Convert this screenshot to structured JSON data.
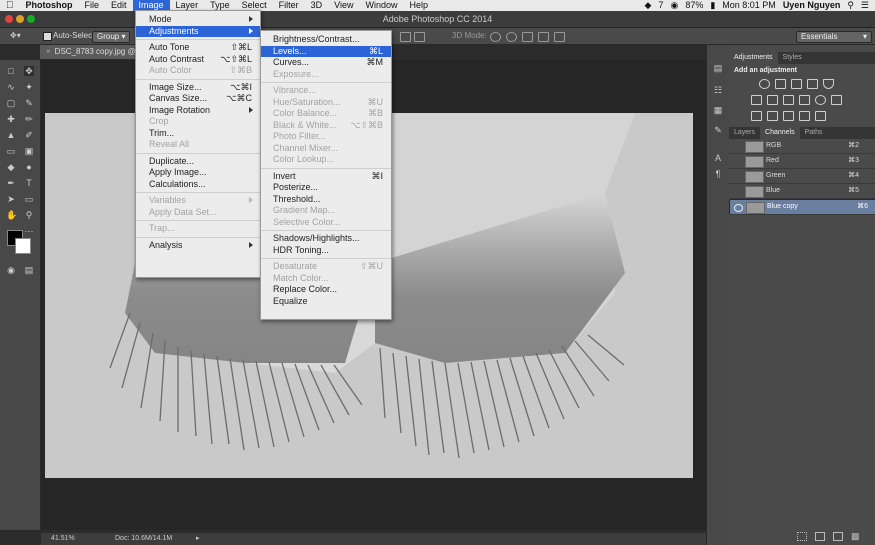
{
  "menubar": {
    "app": "Photoshop",
    "items": [
      "File",
      "Edit",
      "Image",
      "Layer",
      "Type",
      "Select",
      "Filter",
      "3D",
      "View",
      "Window",
      "Help"
    ],
    "active": "Image",
    "status": {
      "badge": "7",
      "battery": "87%",
      "clock": "Mon 8:01 PM",
      "user": "Uyen Nguyen"
    }
  },
  "window": {
    "title": "Adobe Photoshop CC 2014"
  },
  "options_bar": {
    "auto_select_label": "Auto-Select:",
    "auto_select_value": "Group",
    "mode_3d_label": "3D Mode:",
    "workspace": "Essentials"
  },
  "document": {
    "tab_label": "DSC_8783 copy.jpg @",
    "zoom": "41.51%",
    "doc_size": "Doc: 10.6M/14.1M"
  },
  "image_menu": [
    {
      "type": "item",
      "label": "Mode",
      "shortcut": "",
      "submenu": true,
      "disabled": false
    },
    {
      "type": "item",
      "label": "Adjustments",
      "shortcut": "",
      "submenu": true,
      "disabled": false,
      "highlighted": true
    },
    {
      "type": "sep"
    },
    {
      "type": "item",
      "label": "Auto Tone",
      "shortcut": "⇧⌘L",
      "disabled": false
    },
    {
      "type": "item",
      "label": "Auto Contrast",
      "shortcut": "⌥⇧⌘L",
      "disabled": false
    },
    {
      "type": "item",
      "label": "Auto Color",
      "shortcut": "⇧⌘B",
      "disabled": true
    },
    {
      "type": "sep"
    },
    {
      "type": "item",
      "label": "Image Size...",
      "shortcut": "⌥⌘I",
      "disabled": false
    },
    {
      "type": "item",
      "label": "Canvas Size...",
      "shortcut": "⌥⌘C",
      "disabled": false
    },
    {
      "type": "item",
      "label": "Image Rotation",
      "shortcut": "",
      "submenu": true,
      "disabled": false
    },
    {
      "type": "item",
      "label": "Crop",
      "shortcut": "",
      "disabled": true
    },
    {
      "type": "item",
      "label": "Trim...",
      "shortcut": "",
      "disabled": false
    },
    {
      "type": "item",
      "label": "Reveal All",
      "shortcut": "",
      "disabled": true
    },
    {
      "type": "sep"
    },
    {
      "type": "item",
      "label": "Duplicate...",
      "shortcut": "",
      "disabled": false
    },
    {
      "type": "item",
      "label": "Apply Image...",
      "shortcut": "",
      "disabled": false
    },
    {
      "type": "item",
      "label": "Calculations...",
      "shortcut": "",
      "disabled": false
    },
    {
      "type": "sep"
    },
    {
      "type": "item",
      "label": "Variables",
      "shortcut": "",
      "submenu": true,
      "disabled": true
    },
    {
      "type": "item",
      "label": "Apply Data Set...",
      "shortcut": "",
      "disabled": true
    },
    {
      "type": "sep"
    },
    {
      "type": "item",
      "label": "Trap...",
      "shortcut": "",
      "disabled": true
    },
    {
      "type": "sep"
    },
    {
      "type": "item",
      "label": "Analysis",
      "shortcut": "",
      "submenu": true,
      "disabled": false
    }
  ],
  "adjustments_menu": [
    {
      "type": "item",
      "label": "Brightness/Contrast...",
      "shortcut": "",
      "disabled": false
    },
    {
      "type": "item",
      "label": "Levels...",
      "shortcut": "⌘L",
      "disabled": false,
      "highlighted": true
    },
    {
      "type": "item",
      "label": "Curves...",
      "shortcut": "⌘M",
      "disabled": false
    },
    {
      "type": "item",
      "label": "Exposure...",
      "shortcut": "",
      "disabled": true
    },
    {
      "type": "sep"
    },
    {
      "type": "item",
      "label": "Vibrance...",
      "shortcut": "",
      "disabled": true
    },
    {
      "type": "item",
      "label": "Hue/Saturation...",
      "shortcut": "⌘U",
      "disabled": true
    },
    {
      "type": "item",
      "label": "Color Balance...",
      "shortcut": "⌘B",
      "disabled": true
    },
    {
      "type": "item",
      "label": "Black & White...",
      "shortcut": "⌥⇧⌘B",
      "disabled": true
    },
    {
      "type": "item",
      "label": "Photo Filter...",
      "shortcut": "",
      "disabled": true
    },
    {
      "type": "item",
      "label": "Channel Mixer...",
      "shortcut": "",
      "disabled": true
    },
    {
      "type": "item",
      "label": "Color Lookup...",
      "shortcut": "",
      "disabled": true
    },
    {
      "type": "sep"
    },
    {
      "type": "item",
      "label": "Invert",
      "shortcut": "⌘I",
      "disabled": false
    },
    {
      "type": "item",
      "label": "Posterize...",
      "shortcut": "",
      "disabled": false
    },
    {
      "type": "item",
      "label": "Threshold...",
      "shortcut": "",
      "disabled": false
    },
    {
      "type": "item",
      "label": "Gradient Map...",
      "shortcut": "",
      "disabled": true
    },
    {
      "type": "item",
      "label": "Selective Color...",
      "shortcut": "",
      "disabled": true
    },
    {
      "type": "sep"
    },
    {
      "type": "item",
      "label": "Shadows/Highlights...",
      "shortcut": "",
      "disabled": false
    },
    {
      "type": "item",
      "label": "HDR Toning...",
      "shortcut": "",
      "disabled": false
    },
    {
      "type": "sep"
    },
    {
      "type": "item",
      "label": "Desaturate",
      "shortcut": "⇧⌘U",
      "disabled": true
    },
    {
      "type": "item",
      "label": "Match Color...",
      "shortcut": "",
      "disabled": true
    },
    {
      "type": "item",
      "label": "Replace Color...",
      "shortcut": "",
      "disabled": false
    },
    {
      "type": "item",
      "label": "Equalize",
      "shortcut": "",
      "disabled": false
    }
  ],
  "adjustments_panel": {
    "tabs": [
      "Adjustments",
      "Styles"
    ],
    "active_tab": "Adjustments",
    "heading": "Add an adjustment"
  },
  "channels_panel": {
    "tabs": [
      "Layers",
      "Channels",
      "Paths"
    ],
    "active_tab": "Channels",
    "channels": [
      {
        "name": "RGB",
        "shortcut": "⌘2",
        "selected": false
      },
      {
        "name": "Red",
        "shortcut": "⌘3",
        "selected": false
      },
      {
        "name": "Green",
        "shortcut": "⌘4",
        "selected": false
      },
      {
        "name": "Blue",
        "shortcut": "⌘5",
        "selected": false
      },
      {
        "name": "Blue copy",
        "shortcut": "⌘6",
        "selected": true
      }
    ]
  },
  "colors": {
    "menu_highlight": "#2c64d8",
    "selected_channel": "#6a7e9f",
    "app_background": "#2b2b2b"
  }
}
